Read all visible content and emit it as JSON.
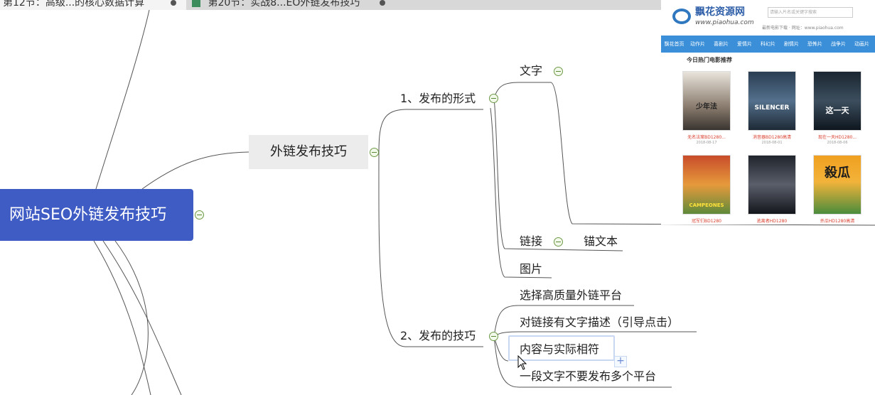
{
  "tabs": [
    {
      "label": "第12节：高级...的核心数据计算",
      "active": true
    },
    {
      "label": "第20节：实战8...EO外链发布技巧",
      "active": false
    }
  ],
  "mindmap": {
    "root": "网站SEO外链发布技巧",
    "main": "外链发布技巧",
    "branch1": {
      "label": "1、发布的形式",
      "children": {
        "text": "文字",
        "link": "链接",
        "anchor": "锚文本",
        "image": "图片"
      }
    },
    "branch2": {
      "label": "2、发布的技巧",
      "children": [
        "选择高质量外链平台",
        "对链接有文字描述（引导点击）",
        "内容与实际相符",
        "一段文字不要发布多个平台"
      ]
    }
  },
  "website": {
    "name": "飘花资源网",
    "url": "www.piaohua.com",
    "search_placeholder": "请输入片名或关键字搜索",
    "tagline": "最新电影下载 · 网址：www.piaohua.com",
    "nav": [
      "飘花首页",
      "动作片",
      "喜剧片",
      "爱情片",
      "科幻片",
      "剧情片",
      "恐怖片",
      "战争片",
      "动画片"
    ],
    "heading": "今日热门电影推荐",
    "posters": [
      {
        "title": "无名法案BD1280...",
        "date": "2018-08-17",
        "word": "少年法"
      },
      {
        "title": "消音器BD1280高清",
        "date": "2018-08-01",
        "word": "SILENCER"
      },
      {
        "title": "现在一天HD1280...",
        "date": "2018-08-06",
        "word": "这一天"
      },
      {
        "title": "冠军们BD1280",
        "date": "",
        "word": "CAMPEONES"
      },
      {
        "title": "逃离者HD1280",
        "date": "",
        "word": ""
      },
      {
        "title": "杀瓜HD1280高清",
        "date": "",
        "word": "殺瓜"
      }
    ]
  },
  "colors": {
    "root_fill": "#3f5bc4",
    "main_fill": "#ececec",
    "collapse_icon": "#6e9a48",
    "selection": "#c8d8f2"
  }
}
